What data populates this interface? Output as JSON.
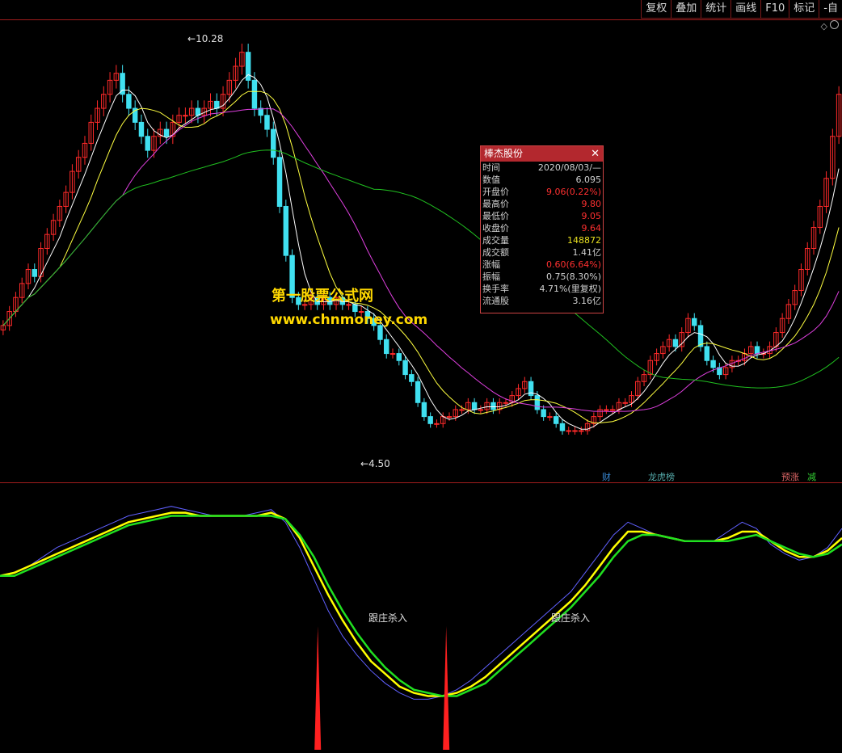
{
  "toolbar": {
    "buttons": [
      "复权",
      "叠加",
      "统计",
      "画线",
      "F10",
      "标记",
      "-自"
    ]
  },
  "watermark": {
    "line1": "第一股票公式网",
    "line2": "www.chnmoney.com"
  },
  "price_labels": {
    "high": "10.28",
    "low": "4.50"
  },
  "badges": [
    {
      "text": "财",
      "color": "#3a8ad6"
    },
    {
      "text": "龙虎榜",
      "color": "#5aa"
    },
    {
      "text": "预涨",
      "color": "#d66"
    },
    {
      "text": "减",
      "color": "#3c3"
    }
  ],
  "indicator_labels": [
    "跟庄杀入",
    "跟庄杀入"
  ],
  "info_panel": {
    "title": "棒杰股份",
    "close_glyph": "✕",
    "rows": [
      {
        "key": "时间",
        "value": "2020/08/03/—",
        "color": "#d0d0d0"
      },
      {
        "key": "数值",
        "value": "6.095",
        "color": "#d0d0d0"
      },
      {
        "key": "开盘价",
        "value": "9.06(0.22%)",
        "color": "#ff3030"
      },
      {
        "key": "最高价",
        "value": "9.80",
        "color": "#ff3030"
      },
      {
        "key": "最低价",
        "value": "9.05",
        "color": "#ff3030"
      },
      {
        "key": "收盘价",
        "value": "9.64",
        "color": "#ff3030"
      },
      {
        "key": "成交量",
        "value": "148872",
        "color": "#e8e020"
      },
      {
        "key": "成交额",
        "value": "1.41亿",
        "color": "#d0d0d0"
      },
      {
        "key": "涨幅",
        "value": "0.60(6.64%)",
        "color": "#ff3030"
      },
      {
        "key": "振幅",
        "value": "0.75(8.30%)",
        "color": "#d0d0d0"
      },
      {
        "key": "换手率",
        "value": "4.71%(里复权)",
        "color": "#d0d0d0"
      },
      {
        "key": "流通股",
        "value": "3.16亿",
        "color": "#d0d0d0"
      }
    ]
  },
  "colors": {
    "up": "#ff2a2a",
    "down": "#40e0f0",
    "ma5": "#ffffff",
    "ma10": "#ffff40",
    "ma20": "#e040e0",
    "ma60": "#20c020",
    "osc_blue": "#6060ff",
    "osc_yellow": "#ffff00",
    "osc_green": "#20e020",
    "signal": "#ff2020"
  },
  "chart_data": {
    "type": "candlestick",
    "price_range": [
      4.2,
      10.6
    ],
    "closes": [
      6.3,
      6.5,
      6.7,
      6.9,
      7.1,
      7.0,
      7.4,
      7.6,
      7.8,
      8.0,
      8.2,
      8.5,
      8.7,
      8.9,
      9.2,
      9.4,
      9.6,
      9.8,
      9.9,
      9.6,
      9.4,
      9.2,
      9.0,
      8.8,
      9.0,
      9.1,
      9.0,
      9.2,
      9.3,
      9.3,
      9.4,
      9.3,
      9.4,
      9.5,
      9.4,
      9.6,
      9.8,
      10.0,
      10.2,
      9.8,
      9.4,
      9.3,
      9.1,
      8.7,
      8.0,
      7.3,
      6.7,
      6.6,
      6.6,
      6.7,
      6.6,
      6.7,
      6.6,
      6.7,
      6.6,
      6.6,
      6.5,
      6.5,
      6.4,
      6.3,
      6.1,
      5.9,
      5.9,
      5.8,
      5.6,
      5.5,
      5.2,
      5.0,
      4.9,
      4.9,
      5.0,
      5.0,
      5.1,
      5.1,
      5.2,
      5.1,
      5.1,
      5.2,
      5.1,
      5.2,
      5.2,
      5.3,
      5.4,
      5.5,
      5.3,
      5.1,
      5.0,
      5.0,
      4.9,
      4.8,
      4.8,
      4.8,
      4.8,
      4.9,
      5.0,
      5.1,
      5.1,
      5.1,
      5.2,
      5.2,
      5.3,
      5.5,
      5.6,
      5.8,
      5.9,
      6.0,
      6.1,
      6.0,
      6.2,
      6.4,
      6.3,
      6.0,
      5.8,
      5.7,
      5.6,
      5.7,
      5.8,
      5.8,
      5.9,
      6.0,
      5.9,
      5.9,
      6.0,
      6.2,
      6.4,
      6.6,
      6.8,
      7.1,
      7.4,
      7.7,
      8.0,
      8.4,
      9.0,
      9.6
    ],
    "osc_series": [
      {
        "name": "",
        "values": [
          55,
          56,
          58,
          61,
          64,
          66,
          68,
          70,
          72,
          74,
          75,
          76,
          77,
          76,
          75,
          74,
          74,
          74,
          75,
          76,
          72,
          64,
          54,
          44,
          36,
          30,
          25,
          21,
          18,
          16,
          16,
          17,
          19,
          22,
          26,
          30,
          34,
          38,
          42,
          46,
          50,
          56,
          62,
          68,
          72,
          70,
          68,
          67,
          66,
          66,
          66,
          69,
          72,
          70,
          65,
          62,
          60,
          61,
          64,
          70
        ]
      },
      {
        "name": "",
        "values": [
          55,
          56,
          58,
          60,
          62,
          64,
          66,
          68,
          70,
          72,
          73,
          74,
          75,
          75,
          74,
          74,
          74,
          74,
          74,
          75,
          73,
          67,
          58,
          49,
          41,
          34,
          28,
          24,
          20,
          18,
          17,
          17,
          18,
          20,
          23,
          27,
          31,
          35,
          39,
          43,
          47,
          52,
          58,
          64,
          69,
          69,
          68,
          67,
          66,
          66,
          66,
          67,
          69,
          69,
          66,
          63,
          61,
          61,
          63,
          67
        ]
      },
      {
        "name": "",
        "values": [
          55,
          55,
          57,
          59,
          61,
          63,
          65,
          67,
          69,
          71,
          72,
          73,
          74,
          74,
          74,
          74,
          74,
          74,
          74,
          74,
          73,
          68,
          61,
          52,
          44,
          37,
          31,
          26,
          22,
          19,
          18,
          17,
          17,
          19,
          21,
          25,
          29,
          33,
          37,
          41,
          45,
          50,
          55,
          61,
          66,
          68,
          68,
          67,
          66,
          66,
          66,
          66,
          67,
          68,
          66,
          64,
          62,
          61,
          62,
          65
        ]
      }
    ],
    "signal_indices": [
      20,
      29
    ]
  }
}
